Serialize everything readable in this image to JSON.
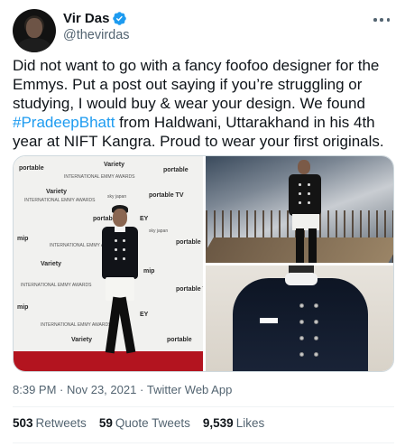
{
  "author": {
    "display_name": "Vir Das",
    "handle": "@thevirdas"
  },
  "tweet": {
    "text_part1": "Did not want to go with a fancy foofoo designer for the Emmys. Put a post out saying if you’re struggling or studying, I would buy & wear your design. We found ",
    "hashtag": "#PradeepBhatt",
    "text_part2": " from Haldwani, Uttarakhand in his 4th year at NIFT Kangra. Proud to wear your first originals."
  },
  "media": {
    "backdrop_logos": [
      "portable",
      "Variety",
      "INTERNATIONAL EMMY AWARDS",
      "EY",
      "mip",
      "sky japan",
      "portable TV"
    ]
  },
  "meta": {
    "time": "8:39 PM",
    "separator": " · ",
    "date": "Nov 23, 2021",
    "source": "Twitter Web App"
  },
  "stats": {
    "retweets_count": "503",
    "retweets_label": "Retweets",
    "quotes_count": "59",
    "quotes_label": "Quote Tweets",
    "likes_count": "9,539",
    "likes_label": "Likes"
  },
  "colors": {
    "accent": "#1d9bf0",
    "secondary_text": "#536471",
    "primary_text": "#0f1419"
  }
}
